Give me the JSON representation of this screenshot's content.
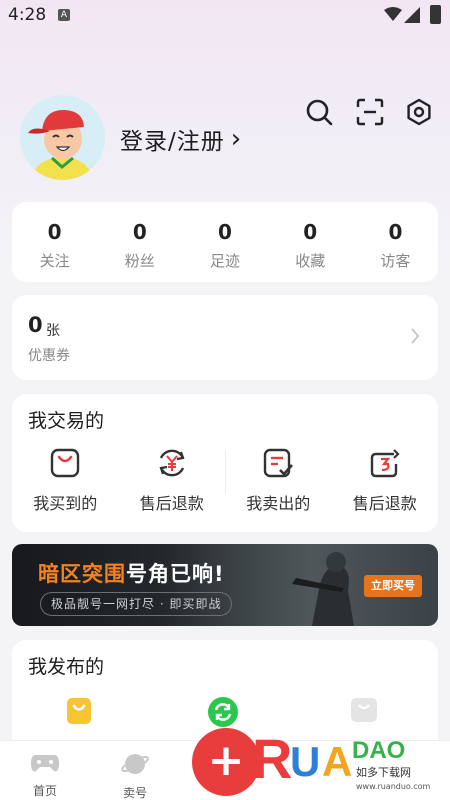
{
  "status_bar": {
    "time": "4:28",
    "input_indicator": "A"
  },
  "header": {
    "login_label": "登录/注册",
    "login_chevron": "›",
    "icons": [
      "search-icon",
      "scan-icon",
      "settings-icon"
    ]
  },
  "stats": [
    {
      "value": "0",
      "label": "关注"
    },
    {
      "value": "0",
      "label": "粉丝"
    },
    {
      "value": "0",
      "label": "足迹"
    },
    {
      "value": "0",
      "label": "收藏"
    },
    {
      "value": "0",
      "label": "访客"
    }
  ],
  "coupon": {
    "value": "0",
    "unit": "张",
    "label": "优惠券"
  },
  "trade": {
    "title": "我交易的",
    "items": [
      {
        "label": "我买到的",
        "icon": "bag-icon"
      },
      {
        "label": "售后退款",
        "icon": "yen-refresh-icon"
      },
      {
        "label": "我卖出的",
        "icon": "checklist-icon"
      },
      {
        "label": "售后退款",
        "icon": "return-icon"
      }
    ]
  },
  "banner": {
    "headline_orange": "暗区突围",
    "headline_white": "号角已响!",
    "subline": "极品靓号一网打尽 · 即买即战",
    "button": "立即买号"
  },
  "publish": {
    "title": "我发布的"
  },
  "tabbar": {
    "tabs": [
      {
        "label": "首页"
      },
      {
        "label": "卖号"
      }
    ],
    "fab_symbol": "+"
  },
  "watermark": {
    "brand": "RUANDAO",
    "cn": "如多下载网",
    "url": "www.ruanduo.com"
  },
  "colors": {
    "accent_red": "#e93d3d",
    "banner_orange": "#f6821f"
  }
}
